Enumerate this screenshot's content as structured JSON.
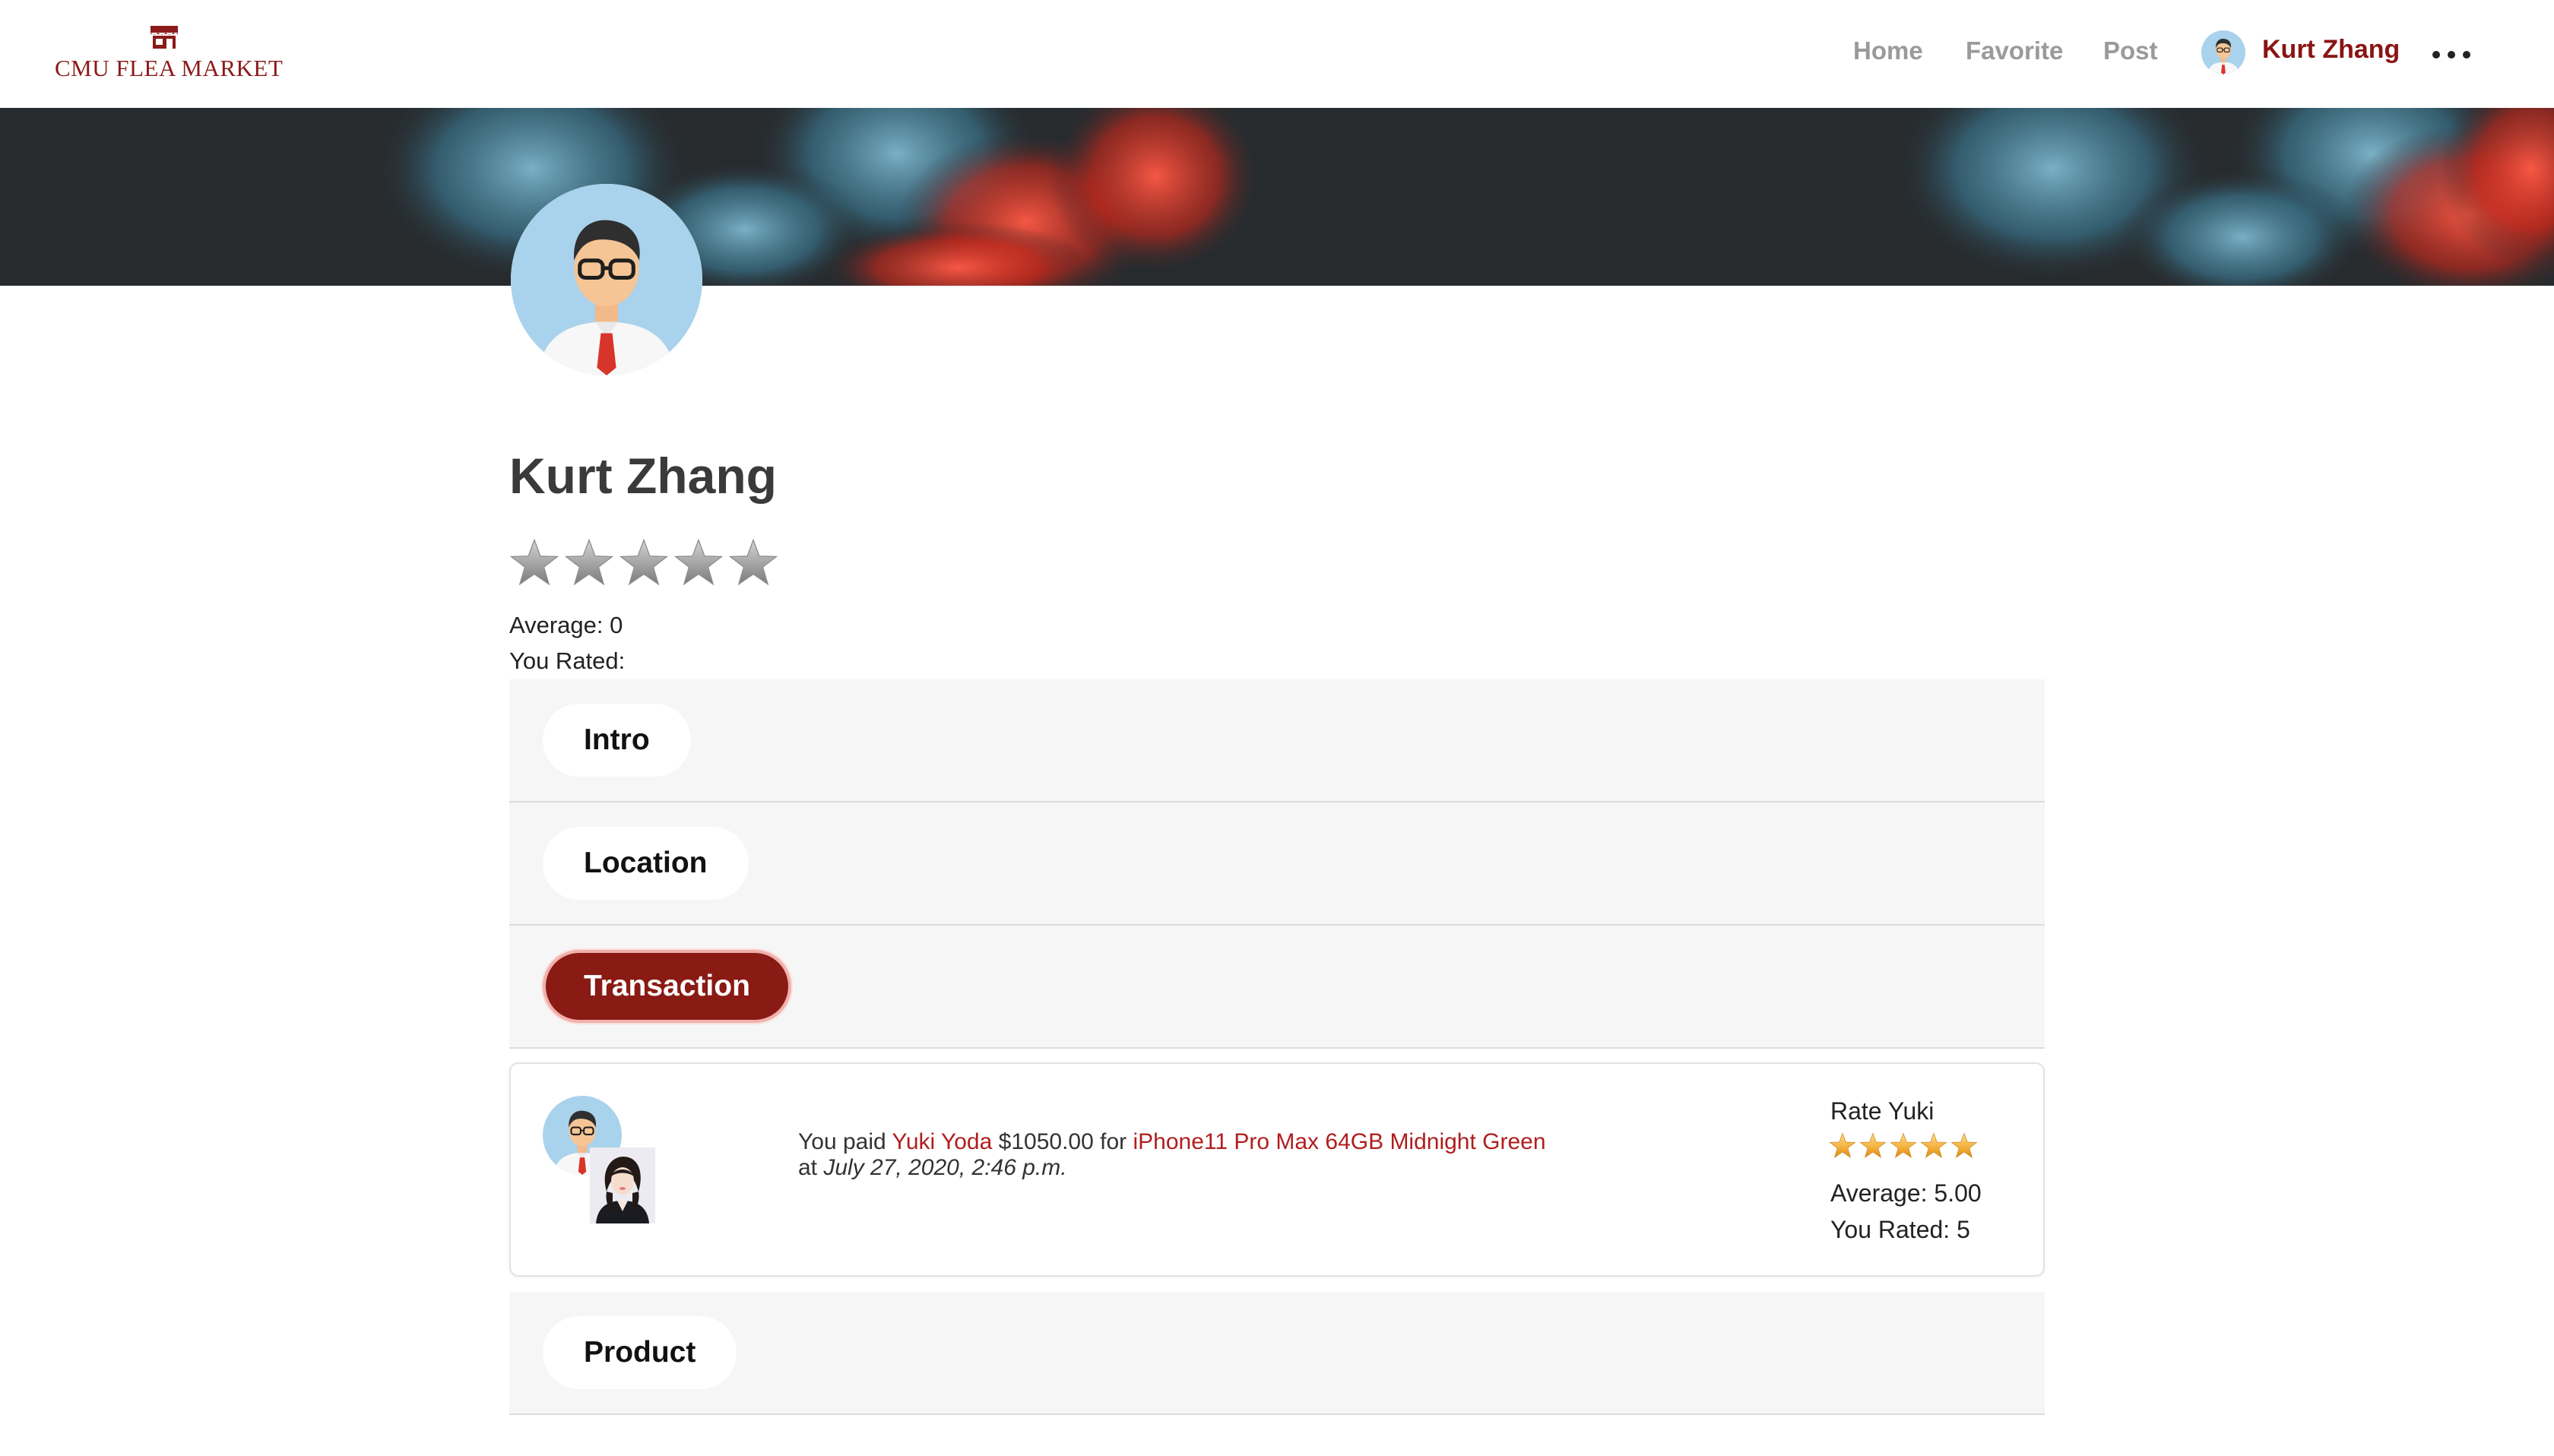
{
  "brand": {
    "name": "CMU FLEA MARKET",
    "color": "#8b1a1a",
    "icon": "store-icon"
  },
  "nav": {
    "home": "Home",
    "favorite": "Favorite",
    "post": "Post",
    "user_name": "Kurt Zhang",
    "more_icon": "more-horizontal-icon"
  },
  "profile": {
    "name": "Kurt Zhang",
    "stars_filled": 0,
    "stars_total": 5,
    "average_label": "Average: 0",
    "you_rated_label": "You Rated:"
  },
  "sections": {
    "intro": "Intro",
    "location": "Location",
    "transaction": "Transaction",
    "product": "Product",
    "active": "transaction"
  },
  "transaction": {
    "prefix": "You paid",
    "counterparty": "Yuki Yoda",
    "amount": "$1050.00 for",
    "item": "iPhone11 Pro Max 64GB Midnight Green",
    "at": "at",
    "date": "July 27, 2020, 2:46 p.m.",
    "rate_title": "Rate Yuki",
    "rate_stars_filled": 5,
    "rate_average": "Average: 5.00",
    "rate_you": "You Rated: 5"
  },
  "colors": {
    "accent": "#8a1a14",
    "link": "#b01e1e",
    "nav_inactive": "#9a9a9a",
    "banner_base": "#272b2e",
    "star_gold": "#f5b342",
    "star_gray": "#a8a8a8"
  }
}
